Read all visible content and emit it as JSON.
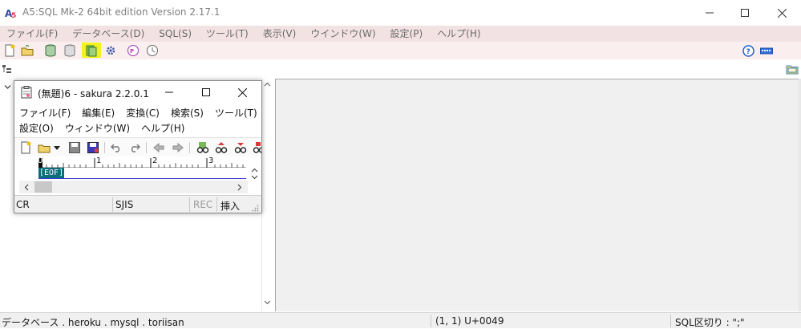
{
  "window": {
    "title": "A5:SQL Mk-2 64bit edition Version 2.17.1",
    "app_icon": "a5-logo-icon",
    "controls": [
      "minimize-icon",
      "maximize-icon",
      "close-icon"
    ]
  },
  "menubar": {
    "items": [
      "ファイル(F)",
      "データベース(D)",
      "SQL(S)",
      "ツール(T)",
      "表示(V)",
      "ウインドウ(W)",
      "設定(P)",
      "ヘルプ(H)"
    ]
  },
  "toolbar": {
    "icons": [
      "new-file-icon",
      "open-folder-icon",
      "connect-database-icon",
      "disconnect-database-icon",
      "database-list-icon",
      "settings-icon",
      "plugin-icon",
      "history-icon"
    ],
    "right_icons": [
      "help-icon",
      "keyboard-icon"
    ]
  },
  "statusbar": {
    "database": "データベース . heroku . mysql . toriisan",
    "position": "(1, 1) U+0049",
    "sql_delimiter": "SQL区切り : \";\""
  },
  "sakura": {
    "title": "(無題)6 - sakura 2.2.0.1",
    "menu_row1": [
      "ファイル(F)",
      "編集(E)",
      "変換(C)",
      "検索(S)",
      "ツール(T)"
    ],
    "menu_row2": [
      "設定(O)",
      "ウィンドウ(W)",
      "ヘルプ(H)"
    ],
    "ruler_numbers": [
      "0",
      "1",
      "2",
      "3"
    ],
    "eof_marker": "[EOF]",
    "status": {
      "line_ending": "CR",
      "encoding": "SJIS",
      "rec": "REC",
      "mode": "挿入"
    }
  },
  "colors": {
    "menubar_bg": "#f3e2e4",
    "toolbar_bg": "#fbeeef",
    "highlight": "#f2f21e",
    "eof_bg": "#0b6e7a"
  }
}
